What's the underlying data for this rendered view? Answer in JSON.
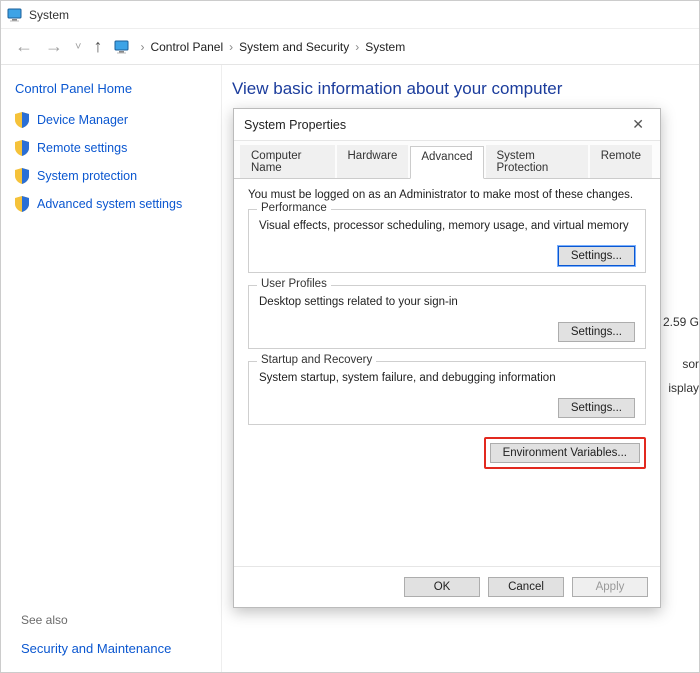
{
  "window": {
    "title": "System"
  },
  "breadcrumb": {
    "nodes": [
      "Control Panel",
      "System and Security",
      "System"
    ]
  },
  "sidebar": {
    "home": "Control Panel Home",
    "items": [
      {
        "label": "Device Manager"
      },
      {
        "label": "Remote settings"
      },
      {
        "label": "System protection"
      },
      {
        "label": "Advanced system settings"
      }
    ],
    "seealso_label": "See also",
    "seealso_link": "Security and Maintenance"
  },
  "mainpane": {
    "heading": "View basic information about your computer",
    "right_frag_1": "2.59 G",
    "right_frag_2": "sor",
    "right_frag_3": "isplay"
  },
  "dialog": {
    "title": "System Properties",
    "tabs": [
      "Computer Name",
      "Hardware",
      "Advanced",
      "System Protection",
      "Remote"
    ],
    "active_tab_index": 2,
    "admin_note": "You must be logged on as an Administrator to make most of these changes.",
    "groups": {
      "performance": {
        "legend": "Performance",
        "desc": "Visual effects, processor scheduling, memory usage, and virtual memory",
        "button": "Settings..."
      },
      "user_profiles": {
        "legend": "User Profiles",
        "desc": "Desktop settings related to your sign-in",
        "button": "Settings..."
      },
      "startup": {
        "legend": "Startup and Recovery",
        "desc": "System startup, system failure, and debugging information",
        "button": "Settings..."
      }
    },
    "env_button": "Environment Variables...",
    "footer": {
      "ok": "OK",
      "cancel": "Cancel",
      "apply": "Apply"
    }
  }
}
